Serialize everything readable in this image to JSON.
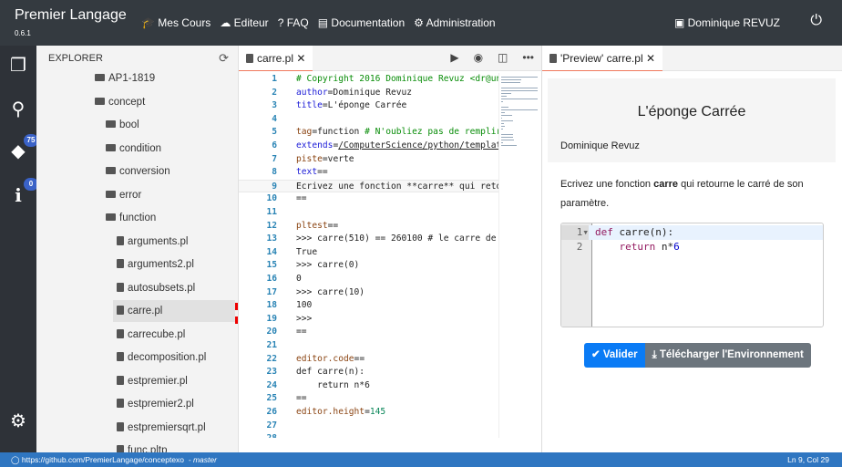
{
  "nav": {
    "brand": "Premier Langage",
    "version": "0.6.1",
    "links": [
      "Mes Cours",
      "Editeur",
      "FAQ",
      "Documentation",
      "Administration"
    ],
    "link_icons": [
      "graduation-cap-icon",
      "cloud-icon",
      "question-icon",
      "book-icon",
      "gear-icon"
    ],
    "user": "Dominique REVUZ"
  },
  "iconbar": {
    "git_badge": "75",
    "info_badge": "0"
  },
  "explorer": {
    "title": "EXPLORER",
    "items": [
      {
        "label": "AP1-1819",
        "type": "folder",
        "level": 0
      },
      {
        "label": "concept",
        "type": "folder",
        "level": 0
      },
      {
        "label": "bool",
        "type": "folder",
        "level": 1
      },
      {
        "label": "condition",
        "type": "folder",
        "level": 1
      },
      {
        "label": "conversion",
        "type": "folder",
        "level": 1
      },
      {
        "label": "error",
        "type": "folder",
        "level": 1
      },
      {
        "label": "function",
        "type": "folder",
        "level": 1
      },
      {
        "label": "arguments.pl",
        "type": "file",
        "level": 2
      },
      {
        "label": "arguments2.pl",
        "type": "file",
        "level": 2
      },
      {
        "label": "autosubsets.pl",
        "type": "file",
        "level": 2
      },
      {
        "label": "carre.pl",
        "type": "file",
        "level": 2,
        "selected": true
      },
      {
        "label": "carrecube.pl",
        "type": "file",
        "level": 2
      },
      {
        "label": "decomposition.pl",
        "type": "file",
        "level": 2
      },
      {
        "label": "estpremier.pl",
        "type": "file",
        "level": 2
      },
      {
        "label": "estpremier2.pl",
        "type": "file",
        "level": 2
      },
      {
        "label": "estpremiersqrt.pl",
        "type": "file",
        "level": 2
      },
      {
        "label": "func.pltp",
        "type": "file",
        "level": 2
      }
    ]
  },
  "editor": {
    "tab": "carre.pl",
    "current_line": 9,
    "lines": [
      [
        [
          "# Copyright 2016 Dominique Revuz <dr@univ",
          "com"
        ]
      ],
      [
        [
          "author",
          "key"
        ],
        [
          "=Dominique Revuz",
          ""
        ]
      ],
      [
        [
          "title",
          "key"
        ],
        [
          "=L'éponge Carrée",
          ""
        ]
      ],
      [],
      [
        [
          "tag",
          "key2"
        ],
        [
          "=function ",
          ""
        ],
        [
          "# N'oubliez pas de remplir c",
          "com"
        ]
      ],
      [
        [
          "extends",
          "key"
        ],
        [
          "=",
          ""
        ],
        [
          "/ComputerScience/python/template/",
          "link"
        ]
      ],
      [
        [
          "piste",
          "key2"
        ],
        [
          "=verte",
          ""
        ]
      ],
      [
        [
          "text",
          "key"
        ],
        [
          "==",
          ""
        ]
      ],
      [
        [
          "Ecrivez une fonction **carre** qui retour",
          ""
        ]
      ],
      [
        [
          "==",
          ""
        ]
      ],
      [],
      [
        [
          "pltest",
          "key2"
        ],
        [
          "==",
          ""
        ]
      ],
      [
        [
          ">>> carre(510) == 260100 # le carre de 51",
          ""
        ]
      ],
      [
        [
          "True",
          ""
        ]
      ],
      [
        [
          ">>> carre(0)",
          ""
        ]
      ],
      [
        [
          "0",
          ""
        ]
      ],
      [
        [
          ">>> carre(10)",
          ""
        ]
      ],
      [
        [
          "100",
          ""
        ]
      ],
      [
        [
          ">>> ",
          ""
        ]
      ],
      [
        [
          "==",
          ""
        ]
      ],
      [],
      [
        [
          "editor.code",
          "key2"
        ],
        [
          "==",
          ""
        ]
      ],
      [
        [
          "def carre(n):",
          ""
        ]
      ],
      [
        [
          "    return n*6",
          ""
        ]
      ],
      [
        [
          "==",
          ""
        ]
      ],
      [
        [
          "editor.height",
          "key2"
        ],
        [
          "=",
          ""
        ],
        [
          "145",
          "num"
        ]
      ],
      [],
      []
    ]
  },
  "preview": {
    "tab": "'Preview' carre.pl",
    "title": "L'éponge Carrée",
    "author": "Dominique Revuz",
    "text_before": "Ecrivez une fonction ",
    "text_bold": "carre",
    "text_after": " qui retourne le carré de son paramètre.",
    "code": [
      [
        [
          "def",
          "kw"
        ],
        [
          " carre(n):",
          ""
        ]
      ],
      [
        [
          "    ",
          ""
        ],
        [
          "return",
          "kw"
        ],
        [
          " n*",
          ""
        ],
        [
          "6",
          "num"
        ]
      ]
    ],
    "validate": "Valider",
    "download": "Télécharger l'Environnement"
  },
  "status": {
    "repo": "https://github.com/PremierLangage/conceptexo",
    "branch": "- master",
    "position": "Ln 9, Col 29"
  },
  "colors": {
    "nav": "#343a40",
    "status": "#2f76c1",
    "validate": "#0a7bf5",
    "download": "#6c757d"
  }
}
